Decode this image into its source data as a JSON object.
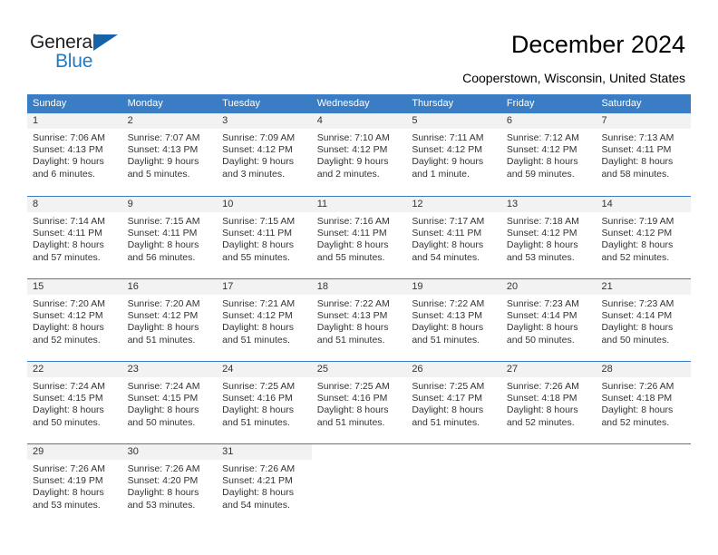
{
  "brand": {
    "name_part1": "General",
    "name_part2": "Blue",
    "logo_icon": "triangle-logo-icon"
  },
  "header": {
    "title": "December 2024",
    "location": "Cooperstown, Wisconsin, United States"
  },
  "calendar": {
    "weekdays": [
      "Sunday",
      "Monday",
      "Tuesday",
      "Wednesday",
      "Thursday",
      "Friday",
      "Saturday"
    ],
    "accent_color": "#3b7dc4",
    "daynum_band_color": "#f2f2f2",
    "weeks": [
      [
        null,
        null,
        null,
        null,
        null,
        null,
        null
      ]
    ],
    "days": [
      {
        "day": "1",
        "weekday": "Sunday",
        "sunrise": "Sunrise: 7:06 AM",
        "sunset": "Sunset: 4:13 PM",
        "daylight_line1": "Daylight: 9 hours",
        "daylight_line2": "and 6 minutes."
      },
      {
        "day": "2",
        "weekday": "Monday",
        "sunrise": "Sunrise: 7:07 AM",
        "sunset": "Sunset: 4:13 PM",
        "daylight_line1": "Daylight: 9 hours",
        "daylight_line2": "and 5 minutes."
      },
      {
        "day": "3",
        "weekday": "Tuesday",
        "sunrise": "Sunrise: 7:09 AM",
        "sunset": "Sunset: 4:12 PM",
        "daylight_line1": "Daylight: 9 hours",
        "daylight_line2": "and 3 minutes."
      },
      {
        "day": "4",
        "weekday": "Wednesday",
        "sunrise": "Sunrise: 7:10 AM",
        "sunset": "Sunset: 4:12 PM",
        "daylight_line1": "Daylight: 9 hours",
        "daylight_line2": "and 2 minutes."
      },
      {
        "day": "5",
        "weekday": "Thursday",
        "sunrise": "Sunrise: 7:11 AM",
        "sunset": "Sunset: 4:12 PM",
        "daylight_line1": "Daylight: 9 hours",
        "daylight_line2": "and 1 minute."
      },
      {
        "day": "6",
        "weekday": "Friday",
        "sunrise": "Sunrise: 7:12 AM",
        "sunset": "Sunset: 4:12 PM",
        "daylight_line1": "Daylight: 8 hours",
        "daylight_line2": "and 59 minutes."
      },
      {
        "day": "7",
        "weekday": "Saturday",
        "sunrise": "Sunrise: 7:13 AM",
        "sunset": "Sunset: 4:11 PM",
        "daylight_line1": "Daylight: 8 hours",
        "daylight_line2": "and 58 minutes."
      },
      {
        "day": "8",
        "weekday": "Sunday",
        "sunrise": "Sunrise: 7:14 AM",
        "sunset": "Sunset: 4:11 PM",
        "daylight_line1": "Daylight: 8 hours",
        "daylight_line2": "and 57 minutes."
      },
      {
        "day": "9",
        "weekday": "Monday",
        "sunrise": "Sunrise: 7:15 AM",
        "sunset": "Sunset: 4:11 PM",
        "daylight_line1": "Daylight: 8 hours",
        "daylight_line2": "and 56 minutes."
      },
      {
        "day": "10",
        "weekday": "Tuesday",
        "sunrise": "Sunrise: 7:15 AM",
        "sunset": "Sunset: 4:11 PM",
        "daylight_line1": "Daylight: 8 hours",
        "daylight_line2": "and 55 minutes."
      },
      {
        "day": "11",
        "weekday": "Wednesday",
        "sunrise": "Sunrise: 7:16 AM",
        "sunset": "Sunset: 4:11 PM",
        "daylight_line1": "Daylight: 8 hours",
        "daylight_line2": "and 55 minutes."
      },
      {
        "day": "12",
        "weekday": "Thursday",
        "sunrise": "Sunrise: 7:17 AM",
        "sunset": "Sunset: 4:11 PM",
        "daylight_line1": "Daylight: 8 hours",
        "daylight_line2": "and 54 minutes."
      },
      {
        "day": "13",
        "weekday": "Friday",
        "sunrise": "Sunrise: 7:18 AM",
        "sunset": "Sunset: 4:12 PM",
        "daylight_line1": "Daylight: 8 hours",
        "daylight_line2": "and 53 minutes."
      },
      {
        "day": "14",
        "weekday": "Saturday",
        "sunrise": "Sunrise: 7:19 AM",
        "sunset": "Sunset: 4:12 PM",
        "daylight_line1": "Daylight: 8 hours",
        "daylight_line2": "and 52 minutes."
      },
      {
        "day": "15",
        "weekday": "Sunday",
        "sunrise": "Sunrise: 7:20 AM",
        "sunset": "Sunset: 4:12 PM",
        "daylight_line1": "Daylight: 8 hours",
        "daylight_line2": "and 52 minutes."
      },
      {
        "day": "16",
        "weekday": "Monday",
        "sunrise": "Sunrise: 7:20 AM",
        "sunset": "Sunset: 4:12 PM",
        "daylight_line1": "Daylight: 8 hours",
        "daylight_line2": "and 51 minutes."
      },
      {
        "day": "17",
        "weekday": "Tuesday",
        "sunrise": "Sunrise: 7:21 AM",
        "sunset": "Sunset: 4:12 PM",
        "daylight_line1": "Daylight: 8 hours",
        "daylight_line2": "and 51 minutes."
      },
      {
        "day": "18",
        "weekday": "Wednesday",
        "sunrise": "Sunrise: 7:22 AM",
        "sunset": "Sunset: 4:13 PM",
        "daylight_line1": "Daylight: 8 hours",
        "daylight_line2": "and 51 minutes."
      },
      {
        "day": "19",
        "weekday": "Thursday",
        "sunrise": "Sunrise: 7:22 AM",
        "sunset": "Sunset: 4:13 PM",
        "daylight_line1": "Daylight: 8 hours",
        "daylight_line2": "and 51 minutes."
      },
      {
        "day": "20",
        "weekday": "Friday",
        "sunrise": "Sunrise: 7:23 AM",
        "sunset": "Sunset: 4:14 PM",
        "daylight_line1": "Daylight: 8 hours",
        "daylight_line2": "and 50 minutes."
      },
      {
        "day": "21",
        "weekday": "Saturday",
        "sunrise": "Sunrise: 7:23 AM",
        "sunset": "Sunset: 4:14 PM",
        "daylight_line1": "Daylight: 8 hours",
        "daylight_line2": "and 50 minutes."
      },
      {
        "day": "22",
        "weekday": "Sunday",
        "sunrise": "Sunrise: 7:24 AM",
        "sunset": "Sunset: 4:15 PM",
        "daylight_line1": "Daylight: 8 hours",
        "daylight_line2": "and 50 minutes."
      },
      {
        "day": "23",
        "weekday": "Monday",
        "sunrise": "Sunrise: 7:24 AM",
        "sunset": "Sunset: 4:15 PM",
        "daylight_line1": "Daylight: 8 hours",
        "daylight_line2": "and 50 minutes."
      },
      {
        "day": "24",
        "weekday": "Tuesday",
        "sunrise": "Sunrise: 7:25 AM",
        "sunset": "Sunset: 4:16 PM",
        "daylight_line1": "Daylight: 8 hours",
        "daylight_line2": "and 51 minutes."
      },
      {
        "day": "25",
        "weekday": "Wednesday",
        "sunrise": "Sunrise: 7:25 AM",
        "sunset": "Sunset: 4:16 PM",
        "daylight_line1": "Daylight: 8 hours",
        "daylight_line2": "and 51 minutes."
      },
      {
        "day": "26",
        "weekday": "Thursday",
        "sunrise": "Sunrise: 7:25 AM",
        "sunset": "Sunset: 4:17 PM",
        "daylight_line1": "Daylight: 8 hours",
        "daylight_line2": "and 51 minutes."
      },
      {
        "day": "27",
        "weekday": "Friday",
        "sunrise": "Sunrise: 7:26 AM",
        "sunset": "Sunset: 4:18 PM",
        "daylight_line1": "Daylight: 8 hours",
        "daylight_line2": "and 52 minutes."
      },
      {
        "day": "28",
        "weekday": "Saturday",
        "sunrise": "Sunrise: 7:26 AM",
        "sunset": "Sunset: 4:18 PM",
        "daylight_line1": "Daylight: 8 hours",
        "daylight_line2": "and 52 minutes."
      },
      {
        "day": "29",
        "weekday": "Sunday",
        "sunrise": "Sunrise: 7:26 AM",
        "sunset": "Sunset: 4:19 PM",
        "daylight_line1": "Daylight: 8 hours",
        "daylight_line2": "and 53 minutes."
      },
      {
        "day": "30",
        "weekday": "Monday",
        "sunrise": "Sunrise: 7:26 AM",
        "sunset": "Sunset: 4:20 PM",
        "daylight_line1": "Daylight: 8 hours",
        "daylight_line2": "and 53 minutes."
      },
      {
        "day": "31",
        "weekday": "Tuesday",
        "sunrise": "Sunrise: 7:26 AM",
        "sunset": "Sunset: 4:21 PM",
        "daylight_line1": "Daylight: 8 hours",
        "daylight_line2": "and 54 minutes."
      }
    ]
  }
}
